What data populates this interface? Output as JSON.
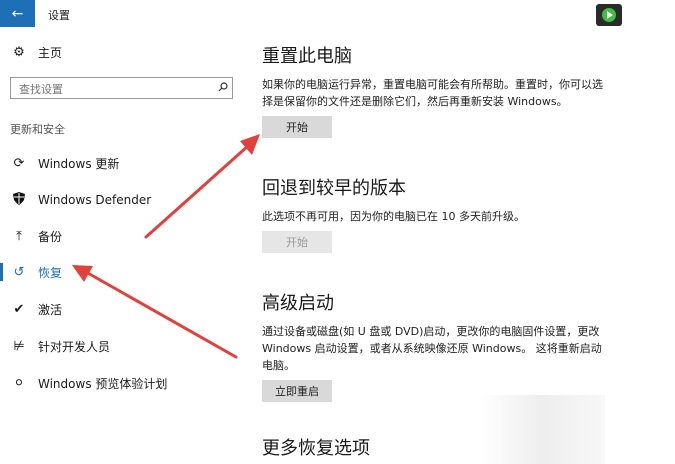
{
  "window": {
    "title": "设置",
    "back_icon": "arrow-left-icon"
  },
  "sidebar": {
    "home_label": "主页",
    "search_placeholder": "查找设置",
    "section_label": "更新和安全",
    "items": [
      {
        "label": "Windows 更新",
        "icon": "sync-icon"
      },
      {
        "label": "Windows Defender",
        "icon": "shield-icon"
      },
      {
        "label": "备份",
        "icon": "backup-arrow-icon"
      },
      {
        "label": "恢复",
        "icon": "history-icon",
        "active": true
      },
      {
        "label": "激活",
        "icon": "check-circle-icon"
      },
      {
        "label": "针对开发人员",
        "icon": "developer-icon"
      },
      {
        "label": "Windows 预览体验计划",
        "icon": "person-icon"
      }
    ]
  },
  "main": {
    "reset": {
      "title": "重置此电脑",
      "description": "如果你的电脑运行异常，重置电脑可能会有所帮助。重置时，你可以选择是保留你的文件还是删除它们，然后再重新安装 Windows。",
      "button": "开始"
    },
    "rollback": {
      "title": "回退到较早的版本",
      "description": "此选项不再可用，因为你的电脑已在 10 多天前升级。",
      "button": "开始"
    },
    "advanced": {
      "title": "高级启动",
      "description": "通过设备或磁盘(如 U 盘或 DVD)启动，更改你的电脑固件设置，更改 Windows 启动设置，或者从系统映像还原 Windows。 这将重新启动电脑。",
      "button": "立即重启"
    },
    "more": {
      "title": "更多恢复选项"
    }
  },
  "colors": {
    "accent": "#1d6fb8",
    "arrow": "#e0413a",
    "button_bg": "#d9d9d9"
  }
}
